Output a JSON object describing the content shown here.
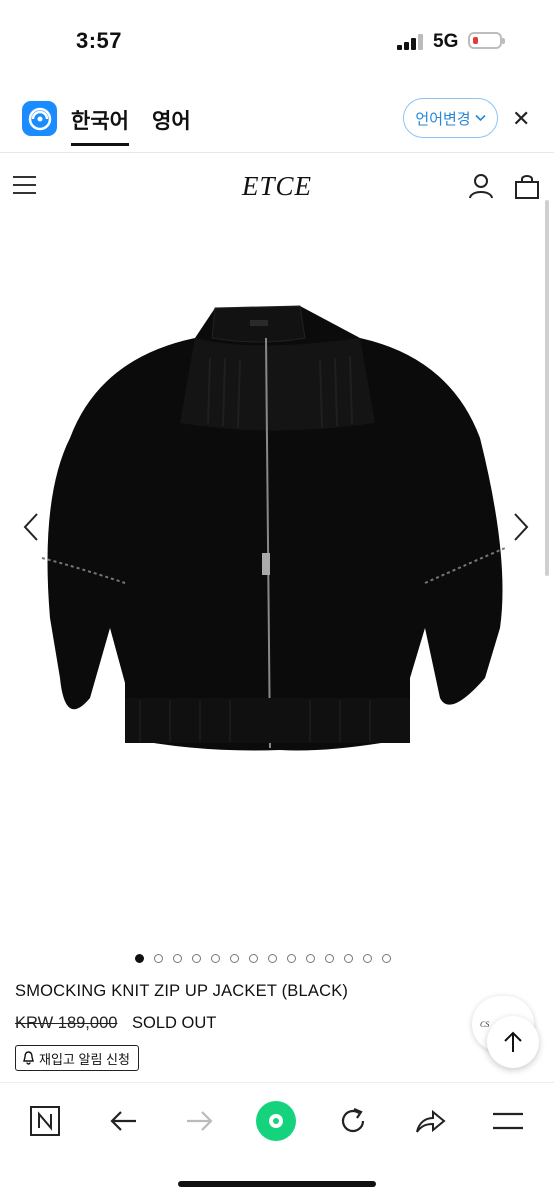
{
  "status": {
    "time": "3:57",
    "network": "5G"
  },
  "translate_bar": {
    "active_language": "한국어",
    "other_language": "영어",
    "change_button": "언어변경"
  },
  "site": {
    "brand": "ETCE"
  },
  "product": {
    "title": "SMOCKING KNIT ZIP UP JACKET (BLACK)",
    "original_price": "KRW 189,000",
    "status": "SOLD OUT",
    "restock_button": "재입고 알림 신청",
    "gallery_image_count": 14,
    "gallery_active_index": 0
  },
  "chat": {
    "label": "CS"
  },
  "colors": {
    "accent_blue": "#2a87d6",
    "green": "#14d37c"
  }
}
